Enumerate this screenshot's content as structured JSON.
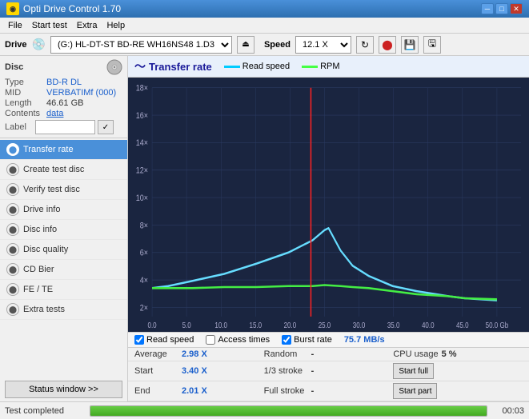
{
  "titlebar": {
    "title": "Opti Drive Control 1.70",
    "min_btn": "─",
    "max_btn": "□",
    "close_btn": "✕"
  },
  "menubar": {
    "items": [
      "File",
      "Start test",
      "Extra",
      "Help"
    ]
  },
  "drivebar": {
    "drive_label": "Drive",
    "drive_value": "(G:)  HL-DT-ST BD-RE  WH16NS48 1.D3",
    "speed_label": "Speed",
    "speed_value": "12.1 X ▾"
  },
  "disc": {
    "type_label": "Type",
    "type_value": "BD-R DL",
    "mid_label": "MID",
    "mid_value": "VERBATIMf (000)",
    "length_label": "Length",
    "length_value": "46.61 GB",
    "contents_label": "Contents",
    "contents_value": "data",
    "label_label": "Label"
  },
  "nav": {
    "items": [
      {
        "id": "transfer-rate",
        "label": "Transfer rate",
        "active": true
      },
      {
        "id": "create-test-disc",
        "label": "Create test disc",
        "active": false
      },
      {
        "id": "verify-test-disc",
        "label": "Verify test disc",
        "active": false
      },
      {
        "id": "drive-info",
        "label": "Drive info",
        "active": false
      },
      {
        "id": "disc-info",
        "label": "Disc info",
        "active": false
      },
      {
        "id": "disc-quality",
        "label": "Disc quality",
        "active": false
      },
      {
        "id": "cd-bier",
        "label": "CD Bier",
        "active": false
      },
      {
        "id": "fe-te",
        "label": "FE / TE",
        "active": false
      },
      {
        "id": "extra-tests",
        "label": "Extra tests",
        "active": false
      }
    ],
    "status_btn": "Status window >>"
  },
  "chart": {
    "title": "Transfer rate",
    "legend": [
      {
        "id": "read-speed",
        "label": "Read speed",
        "color": "#00ccff"
      },
      {
        "id": "rpm",
        "label": "RPM",
        "color": "#44ff44"
      }
    ],
    "x_max": 50.0,
    "x_label": "Gb",
    "y_labels": [
      "18×",
      "16×",
      "14×",
      "12×",
      "10×",
      "8×",
      "6×",
      "4×",
      "2×",
      "0.0"
    ],
    "x_axis_labels": [
      "0.0",
      "5.0",
      "10.0",
      "15.0",
      "20.0",
      "25.0",
      "30.0",
      "35.0",
      "40.0",
      "45.0",
      "50.0 Gb"
    ]
  },
  "checkboxes": {
    "read_speed": {
      "label": "Read speed",
      "checked": true
    },
    "access_times": {
      "label": "Access times",
      "checked": false
    },
    "burst_rate": {
      "label": "Burst rate",
      "checked": true,
      "value": "75.7 MB/s"
    }
  },
  "stats": {
    "rows": [
      {
        "col1_label": "Average",
        "col1_value": "2.98 X",
        "col2_label": "Random",
        "col2_value": "-",
        "col3_label": "CPU usage",
        "col3_value": "5 %",
        "col3_btn": null
      },
      {
        "col1_label": "Start",
        "col1_value": "3.40 X",
        "col2_label": "1/3 stroke",
        "col2_value": "-",
        "col3_btn": "Start full"
      },
      {
        "col1_label": "End",
        "col1_value": "2.01 X",
        "col2_label": "Full stroke",
        "col2_value": "-",
        "col3_btn": "Start part"
      }
    ]
  },
  "statusbar": {
    "text": "Test completed",
    "progress": 100,
    "time": "00:03"
  }
}
